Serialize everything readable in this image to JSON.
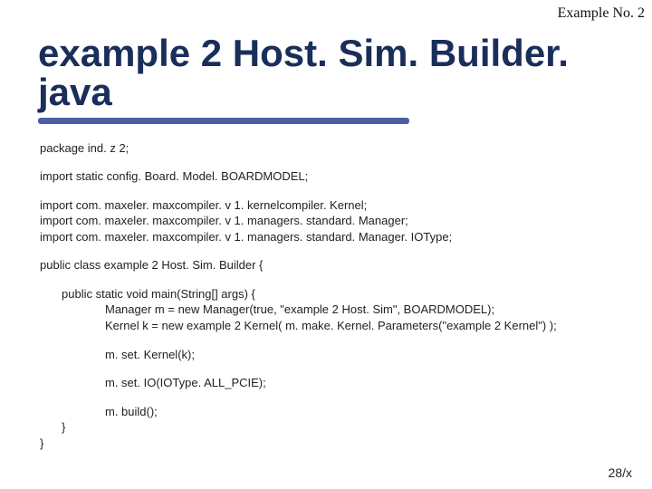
{
  "badge": "Example No. 2",
  "title": "example 2 Host. Sim. Builder. java",
  "code": {
    "pkg": "package ind. z 2;",
    "importStatic": "import static config. Board. Model. BOARDMODEL;",
    "imports": [
      "import com. maxeler. maxcompiler. v 1. kernelcompiler. Kernel;",
      "import com. maxeler. maxcompiler. v 1. managers. standard. Manager;",
      "import com. maxeler. maxcompiler. v 1. managers. standard. Manager. IOType;"
    ],
    "classDecl": "public class example 2 Host. Sim. Builder {",
    "mainDecl": "public static void main(String[] args) {",
    "body": [
      "Manager m = new Manager(true, \"example 2 Host. Sim\", BOARDMODEL);",
      "Kernel k = new example 2 Kernel( m. make. Kernel. Parameters(\"example 2 Kernel\") );"
    ],
    "setKernel": "m. set. Kernel(k);",
    "setIO": "m. set. IO(IOType. ALL_PCIE);",
    "build": "m. build();",
    "closeMain": "}",
    "closeClass": "}"
  },
  "footer": "28/x"
}
